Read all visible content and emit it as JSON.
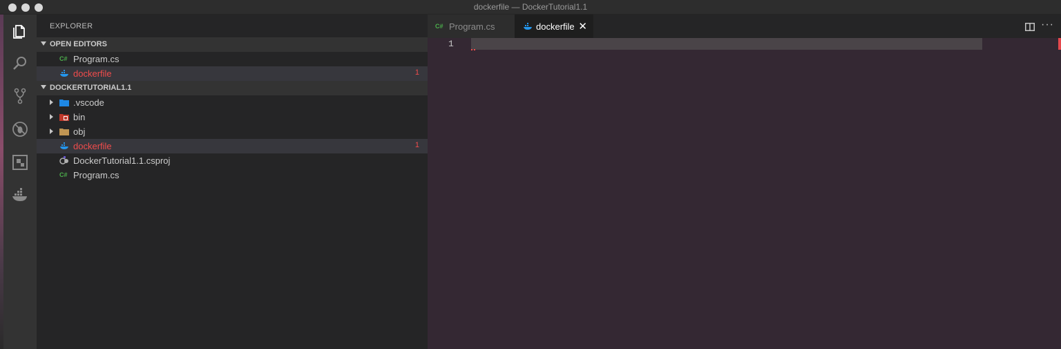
{
  "window": {
    "title": "dockerfile — DockerTutorial1.1"
  },
  "activity_bar": [
    {
      "name": "explorer-icon"
    },
    {
      "name": "search-icon"
    },
    {
      "name": "source-control-icon"
    },
    {
      "name": "debug-icon"
    },
    {
      "name": "extensions-icon"
    },
    {
      "name": "docker-icon"
    }
  ],
  "sidebar": {
    "title": "EXPLORER",
    "open_editors": {
      "label": "OPEN EDITORS",
      "items": [
        {
          "icon": "csharp-file-icon",
          "label": "Program.cs",
          "badge": ""
        },
        {
          "icon": "docker-file-icon",
          "label": "dockerfile",
          "badge": "1"
        }
      ]
    },
    "project": {
      "label": "DOCKERTUTORIAL1.1",
      "items": [
        {
          "icon": "vscode-folder-icon",
          "label": ".vscode",
          "badge": ""
        },
        {
          "icon": "bin-folder-icon",
          "label": "bin",
          "badge": ""
        },
        {
          "icon": "folder-icon",
          "label": "obj",
          "badge": ""
        },
        {
          "icon": "docker-file-icon",
          "label": "dockerfile",
          "badge": "1"
        },
        {
          "icon": "csproj-file-icon",
          "label": "DockerTutorial1.1.csproj",
          "badge": ""
        },
        {
          "icon": "csharp-file-icon",
          "label": "Program.cs",
          "badge": ""
        }
      ]
    }
  },
  "editor": {
    "tabs": [
      {
        "label": "Program.cs",
        "icon": "csharp-file-icon",
        "active": false
      },
      {
        "label": "dockerfile",
        "icon": "docker-file-icon",
        "active": true
      }
    ],
    "csharp_glyph": "C#",
    "line_numbers": [
      "1"
    ],
    "more_glyph": "···",
    "close_glyph": "✕"
  },
  "colors": {
    "error": "#f14c4c",
    "csharp": "#4cae4c",
    "docker": "#2496ed"
  }
}
